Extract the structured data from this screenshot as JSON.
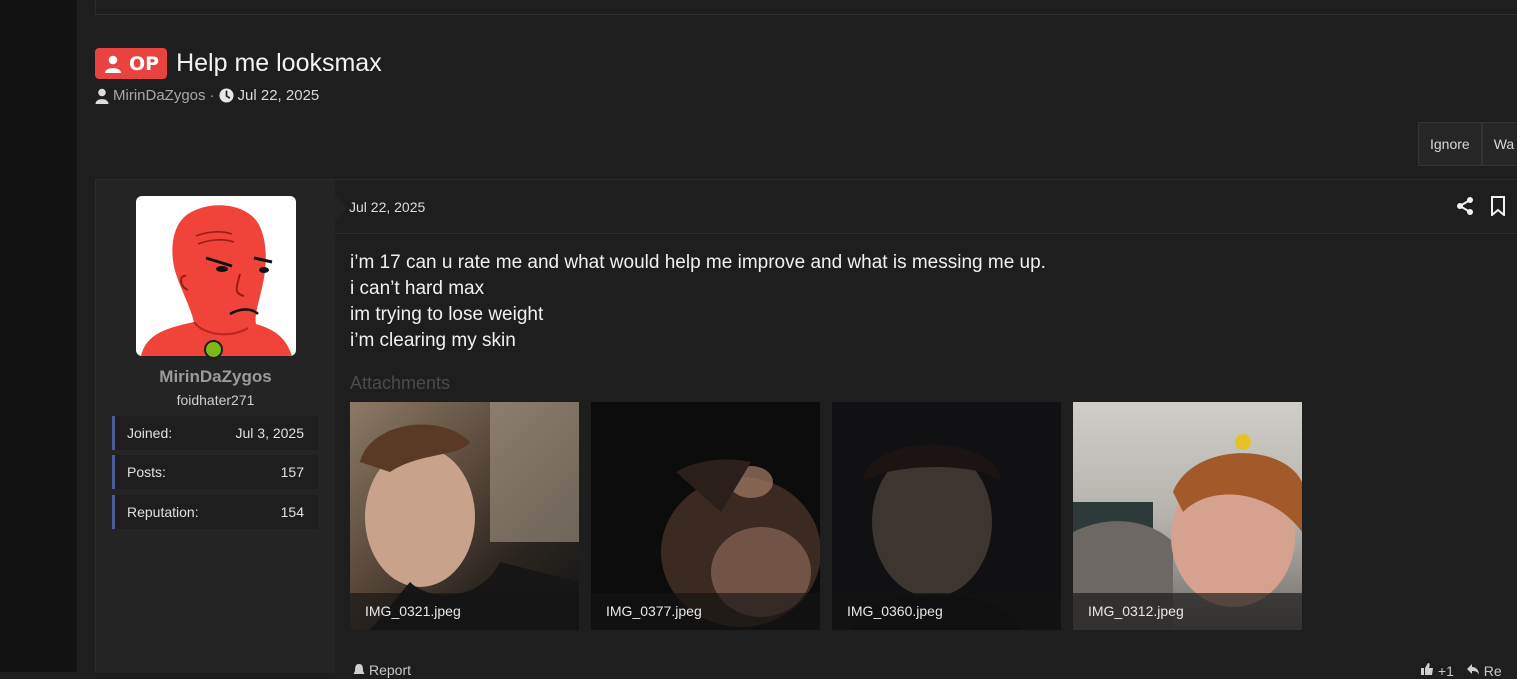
{
  "thread": {
    "badge_label": "OP",
    "title": "Help me looksmax",
    "author": "MirinDaZygos",
    "separator": "·",
    "date": "Jul 22, 2025"
  },
  "actions": {
    "ignore_label": "Ignore",
    "watch_label": "Wa"
  },
  "post": {
    "date": "Jul 22, 2025",
    "body_lines": [
      "i’m 17 can u rate me and what would help me improve and what is messing me up.",
      "i can’t hard max",
      "im trying to lose weight",
      "i’m clearing my skin"
    ],
    "attachments_heading": "Attachments",
    "attachments": [
      {
        "filename": "IMG_0321.jpeg"
      },
      {
        "filename": "IMG_0377.jpeg"
      },
      {
        "filename": "IMG_0360.jpeg"
      },
      {
        "filename": "IMG_0312.jpeg"
      }
    ],
    "footer": {
      "report_label": "Report",
      "reaction_count": "+1",
      "reply_label": "Re"
    }
  },
  "user": {
    "username": "MirinDaZygos",
    "user_title": "foidhater271",
    "online": true,
    "stats": [
      {
        "label": "Joined:",
        "value": "Jul 3, 2025"
      },
      {
        "label": "Posts:",
        "value": "157"
      },
      {
        "label": "Reputation:",
        "value": "154"
      }
    ]
  },
  "colors": {
    "op_badge": "#e8433e",
    "online_dot": "#7cb817",
    "stat_accent": "#4b5c99",
    "background": "#1e1e1e"
  },
  "icons": [
    "user-icon",
    "clock-icon",
    "share-icon",
    "bookmark-icon",
    "bell-icon",
    "thumbs-up-icon",
    "reply-icon"
  ]
}
